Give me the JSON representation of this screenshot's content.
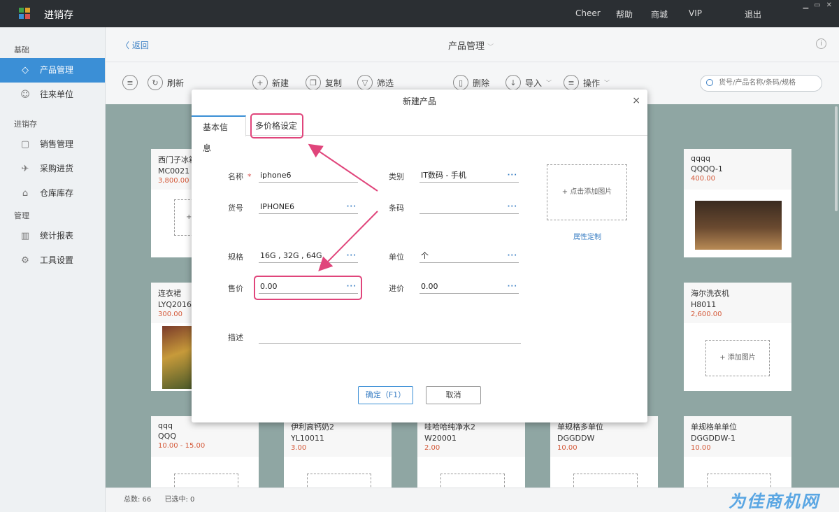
{
  "app": {
    "title": "进销存",
    "logo_colors": [
      "#3fa14a",
      "#e0a22a",
      "#3b8fd6",
      "#d9534f"
    ],
    "nav": [
      {
        "label": "Cheer"
      },
      {
        "label": "帮助"
      },
      {
        "label": "商城"
      },
      {
        "label": "VIP"
      },
      {
        "label": "退出"
      }
    ]
  },
  "sidebar": {
    "sections": [
      {
        "title": "基础",
        "items": [
          {
            "label": "产品管理",
            "icon": "tag-icon",
            "active": true
          },
          {
            "label": "往来单位",
            "icon": "contacts-icon"
          }
        ]
      },
      {
        "title": "进销存",
        "items": [
          {
            "label": "销售管理",
            "icon": "bag-icon"
          },
          {
            "label": "采购进货",
            "icon": "plane-icon"
          },
          {
            "label": "仓库库存",
            "icon": "warehouse-icon"
          }
        ]
      },
      {
        "title": "管理",
        "items": [
          {
            "label": "统计报表",
            "icon": "chart-icon"
          },
          {
            "label": "工具设置",
            "icon": "gear-icon"
          }
        ]
      }
    ]
  },
  "header": {
    "back_label": "返回",
    "title": "产品管理"
  },
  "toolbar": {
    "refresh": "刷新",
    "new": "新建",
    "copy": "复制",
    "filter": "筛选",
    "delete": "删除",
    "import": "导入",
    "operate": "操作",
    "search_placeholder": "货号/产品名称/条码/规格"
  },
  "cards": [
    {
      "name": "西门子冰箱",
      "code": "MC0021",
      "price": "3,800.00",
      "add": "+"
    },
    {
      "name": "qqqq",
      "code": "QQQQ-1",
      "price": "400.00"
    },
    {
      "name": "连衣裙",
      "code": "LYQ2016",
      "price": "300.00"
    },
    {
      "name": "海尔洗衣机",
      "code": "H8011",
      "price": "2,600.00",
      "add": "+ 添加图片"
    },
    {
      "name": "qqq",
      "code": "QQQ",
      "price": "10.00 - 15.00"
    },
    {
      "name": "伊利高钙奶2",
      "code": "YL10011",
      "price": "3.00"
    },
    {
      "name": "哇哈哈纯净水2",
      "code": "W20001",
      "price": "2.00"
    },
    {
      "name": "单规格多单位",
      "code": "DGGDDW",
      "price": "10.00"
    },
    {
      "name": "单规格单单位",
      "code": "DGGDDW-1",
      "price": "10.00"
    }
  ],
  "footer": {
    "total": "总数: 66",
    "selected": "已选中: 0",
    "watermark": "为佳商机网"
  },
  "modal": {
    "title": "新建产品",
    "close": "×",
    "tabs": [
      {
        "label": "基本信息",
        "active": true
      },
      {
        "label": "多价格设定"
      }
    ],
    "fields": {
      "name_label": "名称",
      "name_required": "*",
      "name_value": "iphone6",
      "category_label": "类别",
      "category_value": "IT数码 - 手机",
      "sku_label": "货号",
      "sku_value": "IPHONE6",
      "barcode_label": "条码",
      "barcode_value": "",
      "spec_label": "规格",
      "spec_value": "16G , 32G , 64G",
      "unit_label": "单位",
      "unit_value": "个",
      "sale_price_label": "售价",
      "sale_price_value": "0.00",
      "cost_price_label": "进价",
      "cost_price_value": "0.00",
      "desc_label": "描述",
      "desc_value": "",
      "dots": "···"
    },
    "add_image": "+ 点击添加图片",
    "attr_custom": "属性定制",
    "ok_button": "确定（F1）",
    "cancel_button": "取消"
  },
  "annotation_color": "#e0457b"
}
